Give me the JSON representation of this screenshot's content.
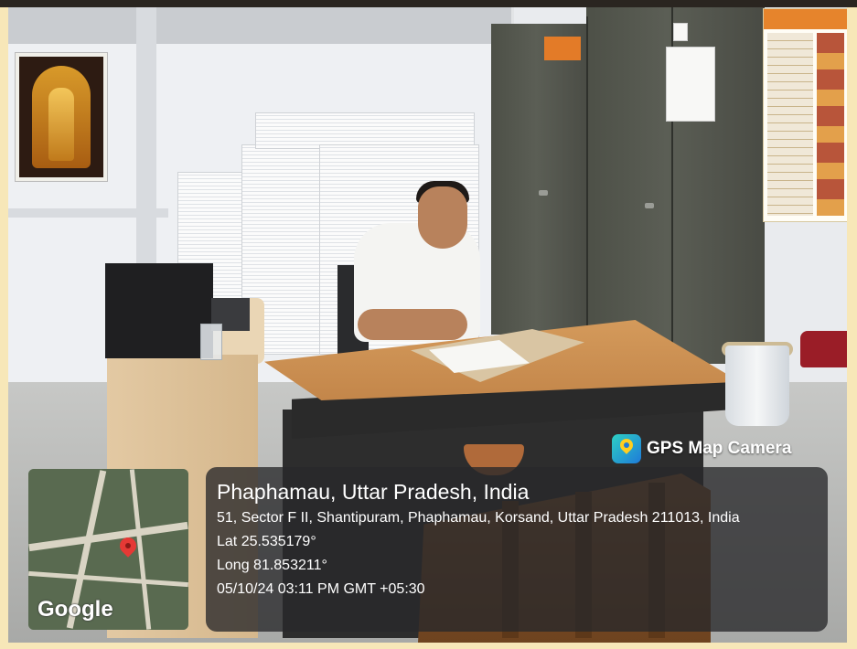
{
  "overlay": {
    "brand": "GPS Map Camera",
    "place_title": "Phaphamau, Uttar Pradesh, India",
    "address": "51, Sector F II, Shantipuram, Phaphamau, Korsand, Uttar Pradesh 211013, India",
    "latitude": "Lat 25.535179°",
    "longitude": "Long 81.853211°",
    "datetime": "05/10/24 03:11 PM GMT +05:30",
    "map_label": "Google"
  },
  "colors": {
    "border": "#f7e7b8",
    "panel_bg": "rgba(40,40,42,0.78)",
    "pin": "#e53935",
    "brand_logo": "#1e7ad9"
  },
  "icons": {
    "brand": "map-pin-camera-icon",
    "map_pin": "location-pin-icon"
  }
}
